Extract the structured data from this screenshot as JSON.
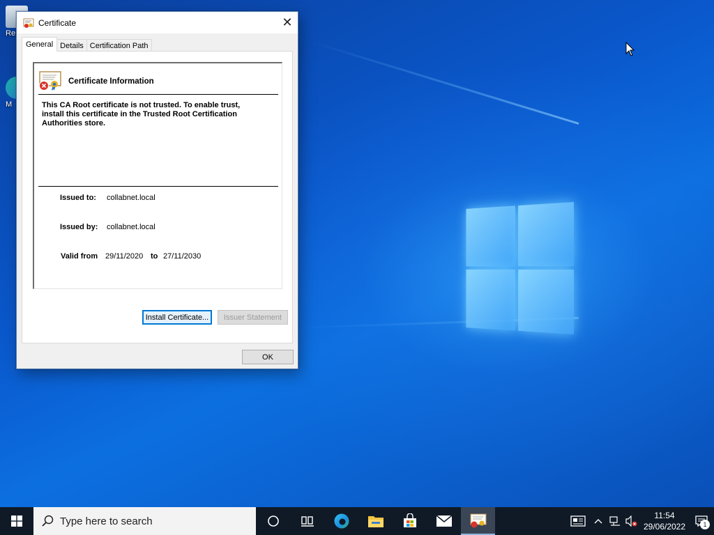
{
  "desktop": {
    "icons": [
      {
        "label": "Re"
      },
      {
        "label": "M"
      }
    ]
  },
  "dialog": {
    "title": "Certificate",
    "close_glyph": "✕",
    "tabs": [
      {
        "label": "General",
        "active": true
      },
      {
        "label": "Details",
        "active": false
      },
      {
        "label": "Certification Path",
        "active": false
      }
    ],
    "info": {
      "heading": "Certificate Information",
      "warning_line1": "This CA Root certificate is not trusted. To enable trust,",
      "warning_line2": "install this certificate in the Trusted Root Certification",
      "warning_line3": "Authorities store.",
      "issued_to_label": "Issued to:",
      "issued_to": "collabnet.local",
      "issued_by_label": "Issued by:",
      "issued_by": "collabnet.local",
      "valid_from_label": "Valid from",
      "valid_from": "29/11/2020",
      "to_label": "to",
      "valid_to": "27/11/2030"
    },
    "buttons": {
      "install": "Install Certificate...",
      "issuer": "Issuer Statement",
      "ok": "OK"
    }
  },
  "taskbar": {
    "search_placeholder": "Type here to search",
    "pinned": [
      "cortana-icon",
      "task-view-icon",
      "edge-icon",
      "file-explorer-icon",
      "store-icon",
      "mail-icon",
      "certificate-icon"
    ],
    "clock_time": "11:54",
    "clock_date": "29/06/2022",
    "notification_count": "1"
  },
  "colors": {
    "accent": "#0078d7",
    "taskbar_bg": "#101a27",
    "desktop_bg": "#0a58cc"
  }
}
